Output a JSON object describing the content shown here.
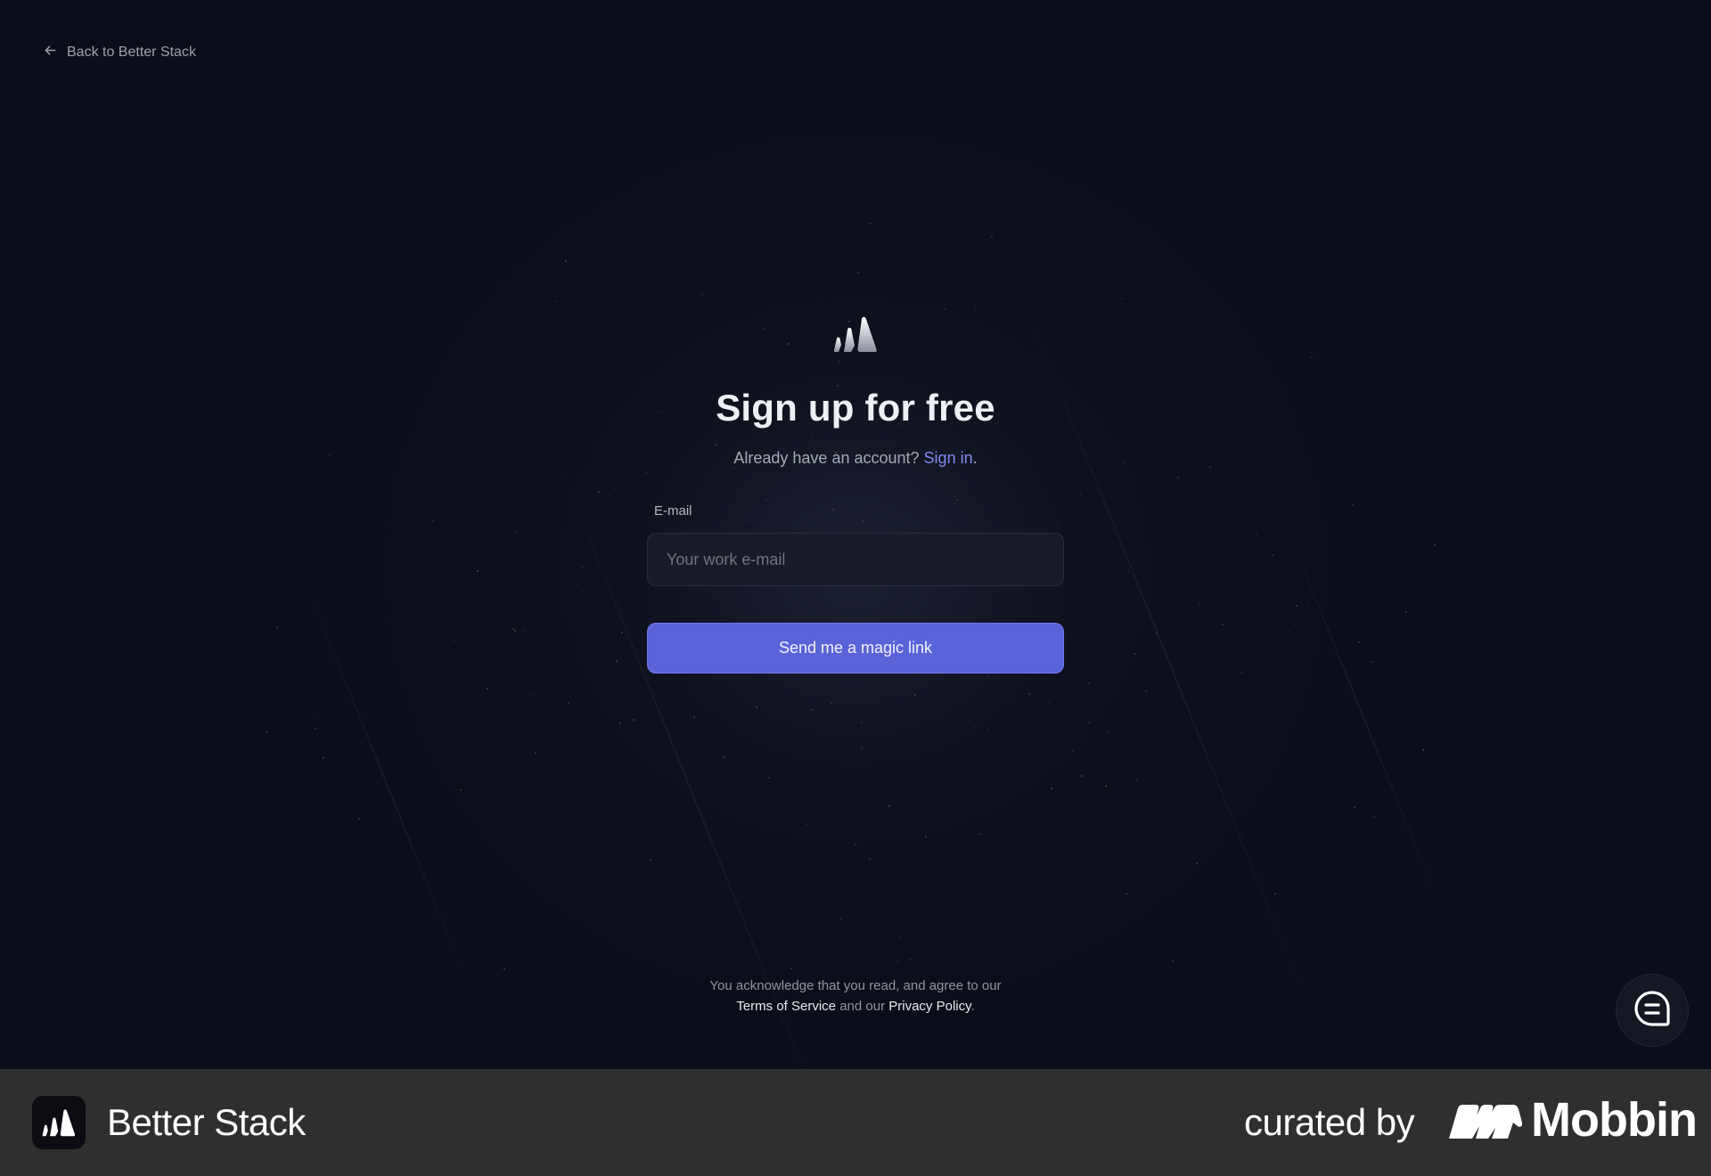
{
  "nav": {
    "back_label": "Back to Better Stack",
    "back_icon": "arrow-left-icon"
  },
  "signup": {
    "logo_icon": "better-stack-logo-icon",
    "title": "Sign up for free",
    "subtitle_prefix": "Already have an account?",
    "signin_label": "Sign in",
    "subtitle_suffix": ".",
    "email_label": "E-mail",
    "email_placeholder": "Your work e-mail",
    "email_value": "",
    "submit_label": "Send me a magic link"
  },
  "legal": {
    "line1": "You acknowledge that you read, and agree to our",
    "terms_label": "Terms of Service",
    "connector": "and our",
    "privacy_label": "Privacy Policy",
    "suffix": "."
  },
  "chat": {
    "icon": "chat-bubble-icon"
  },
  "footer": {
    "app_name": "Better Stack",
    "curated_by": "curated by",
    "brand": "Mobbin"
  },
  "colors": {
    "background": "#0b0e19",
    "accent": "#5b63d9",
    "link": "#8089f0",
    "footer_bg": "#2f2f2f"
  }
}
